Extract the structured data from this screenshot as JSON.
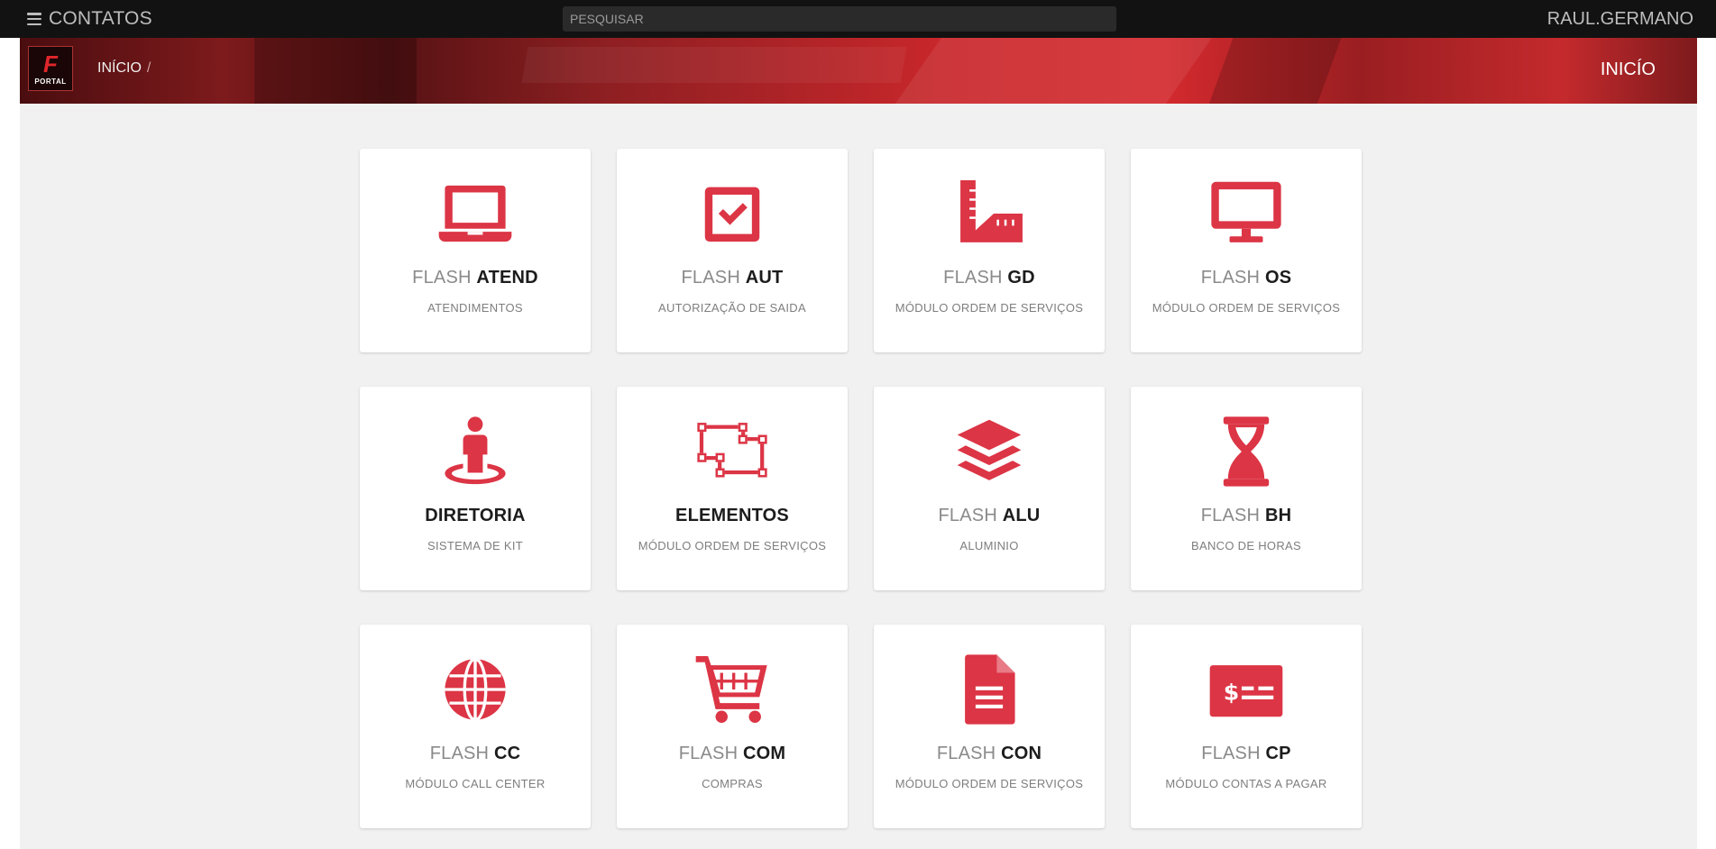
{
  "topbar": {
    "menu_label": "CONTATOS",
    "search_placeholder": "PESQUISAR",
    "search_value": "",
    "user": "RAUL.GERMANO"
  },
  "banner": {
    "logo_text": "PORTAL",
    "breadcrumb": [
      "INÍCIO"
    ],
    "breadcrumb_separator": "/",
    "page_title": "INICÍO"
  },
  "colors": {
    "accent": "#dc3545",
    "topbar": "#121212",
    "content_bg": "#f1f1f1"
  },
  "modules": [
    {
      "light": "FLASH",
      "bold": "ATEND",
      "subtitle": "ATENDIMENTOS",
      "icon": "laptop-icon"
    },
    {
      "light": "FLASH",
      "bold": "AUT",
      "subtitle": "AUTORIZAÇÃO DE SAIDA",
      "icon": "checkbox-icon"
    },
    {
      "light": "FLASH",
      "bold": "GD",
      "subtitle": "MÓDULO ORDEM DE SERVIÇOS",
      "icon": "ruler-combined-icon"
    },
    {
      "light": "FLASH",
      "bold": "OS",
      "subtitle": "MÓDULO ORDEM DE SERVIÇOS",
      "icon": "desktop-icon"
    },
    {
      "light": "",
      "bold": "DIRETORIA",
      "subtitle": "SISTEMA DE KIT",
      "icon": "street-view-icon"
    },
    {
      "light": "",
      "bold": "ELEMENTOS",
      "subtitle": "MÓDULO ORDEM DE SERVIÇOS",
      "icon": "object-group-icon"
    },
    {
      "light": "FLASH",
      "bold": "ALU",
      "subtitle": "ALUMINIO",
      "icon": "layers-icon"
    },
    {
      "light": "FLASH",
      "bold": "BH",
      "subtitle": "BANCO DE HORAS",
      "icon": "hourglass-icon"
    },
    {
      "light": "FLASH",
      "bold": "CC",
      "subtitle": "MÓDULO CALL CENTER",
      "icon": "globe-icon"
    },
    {
      "light": "FLASH",
      "bold": "COM",
      "subtitle": "COMPRAS",
      "icon": "shopping-cart-icon"
    },
    {
      "light": "FLASH",
      "bold": "CON",
      "subtitle": "MÓDULO ORDEM DE SERVIÇOS",
      "icon": "file-text-icon"
    },
    {
      "light": "FLASH",
      "bold": "CP",
      "subtitle": "MÓDULO CONTAS A PAGAR",
      "icon": "money-check-icon"
    }
  ]
}
